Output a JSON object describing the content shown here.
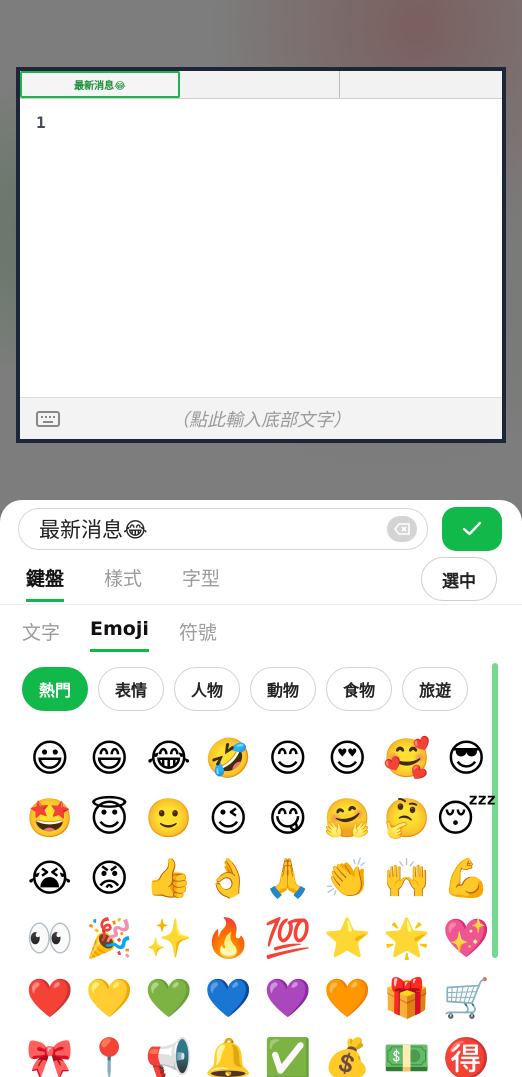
{
  "editor": {
    "tabs": [
      "最新消息😂",
      "",
      ""
    ],
    "line_number": "1",
    "hint": "（點此輸入底部文字）"
  },
  "input": {
    "value": "最新消息😂"
  },
  "main_tabs": [
    "鍵盤",
    "樣式",
    "字型"
  ],
  "select_button": "選中",
  "sub_tabs": [
    "文字",
    "Emoji",
    "符號"
  ],
  "categories": [
    "熱門",
    "表情",
    "人物",
    "動物",
    "食物",
    "旅遊"
  ],
  "emojis": [
    "😃",
    "😄",
    "😂",
    "🤣",
    "😊",
    "😍",
    "🥰",
    "😎",
    "🤩",
    "😇",
    "🙂",
    "😉",
    "😋",
    "🤗",
    "🤔",
    "😴",
    "😭",
    "😡",
    "👍",
    "👌",
    "🙏",
    "👏",
    "🙌",
    "💪",
    "👀",
    "🎉",
    "✨",
    "🔥",
    "💯",
    "⭐",
    "🌟",
    "💖",
    "❤️",
    "💛",
    "💚",
    "💙",
    "💜",
    "🧡",
    "🎁",
    "🛒",
    "🎀",
    "📍",
    "📢",
    "🔔",
    "✅",
    "💰",
    "💵",
    "🉐"
  ],
  "colors": {
    "accent": "#11b84a",
    "editor_frame": "#1d2636"
  }
}
